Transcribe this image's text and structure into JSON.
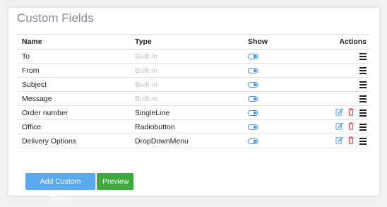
{
  "panel": {
    "title": "Custom Fields"
  },
  "table": {
    "headers": {
      "name": "Name",
      "type": "Type",
      "show": "Show",
      "actions": "Actions"
    },
    "rows": [
      {
        "name": "To",
        "type": "Built-in",
        "builtin": true,
        "show": true
      },
      {
        "name": "From",
        "type": "Built-in",
        "builtin": true,
        "show": true
      },
      {
        "name": "Subject",
        "type": "Built-in",
        "builtin": true,
        "show": true
      },
      {
        "name": "Message",
        "type": "Built-in",
        "builtin": true,
        "show": true
      },
      {
        "name": "Order number",
        "type": "SingleLine",
        "builtin": false,
        "show": true
      },
      {
        "name": "Office",
        "type": "Radiobutton",
        "builtin": false,
        "show": true
      },
      {
        "name": "Delivery Options",
        "type": "DropDownMenu",
        "builtin": false,
        "show": true
      }
    ]
  },
  "buttons": {
    "add_label": "Add Custom Fields",
    "preview_label": "Preview"
  },
  "icons": {
    "show_toggle": "toggle-icon",
    "edit": "edit-icon",
    "delete": "trash-icon",
    "menu": "hamburger-icon"
  },
  "colors": {
    "accent_blue": "#4a90e2",
    "add_button": "#5aa9ea",
    "preview_button": "#3fa83f",
    "delete_red": "#e0393e",
    "builtin_text": "#c3c3c3",
    "title_text": "#8a8d93"
  }
}
